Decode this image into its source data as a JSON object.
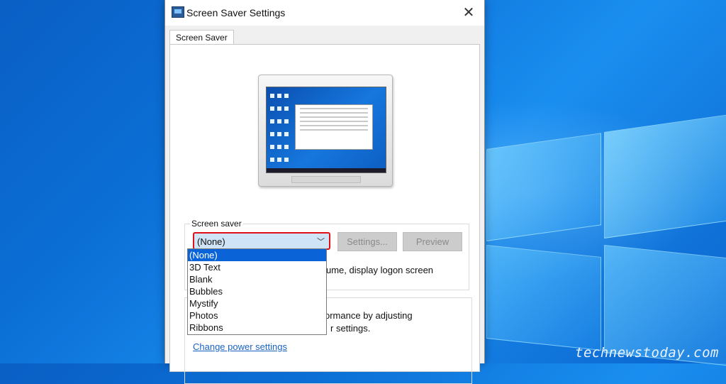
{
  "window": {
    "title": "Screen Saver Settings"
  },
  "tabs": [
    {
      "label": "Screen Saver"
    }
  ],
  "screen_saver": {
    "group_label": "Screen saver",
    "selected_value": "(None)",
    "settings_label": "Settings...",
    "preview_label": "Preview",
    "logon_text": "ume, display logon screen"
  },
  "dropdown": {
    "options": [
      "(None)",
      "3D Text",
      "Blank",
      "Bubbles",
      "Mystify",
      "Photos",
      "Ribbons"
    ],
    "selected_index": 0
  },
  "power": {
    "line1": "ormance by adjusting",
    "line2": "r settings.",
    "link": "Change power settings"
  },
  "watermark": "technewstoday.com",
  "colors": {
    "highlight_border": "#e0101a",
    "selected_option": "#0a64d8",
    "link": "#1a63c5"
  }
}
